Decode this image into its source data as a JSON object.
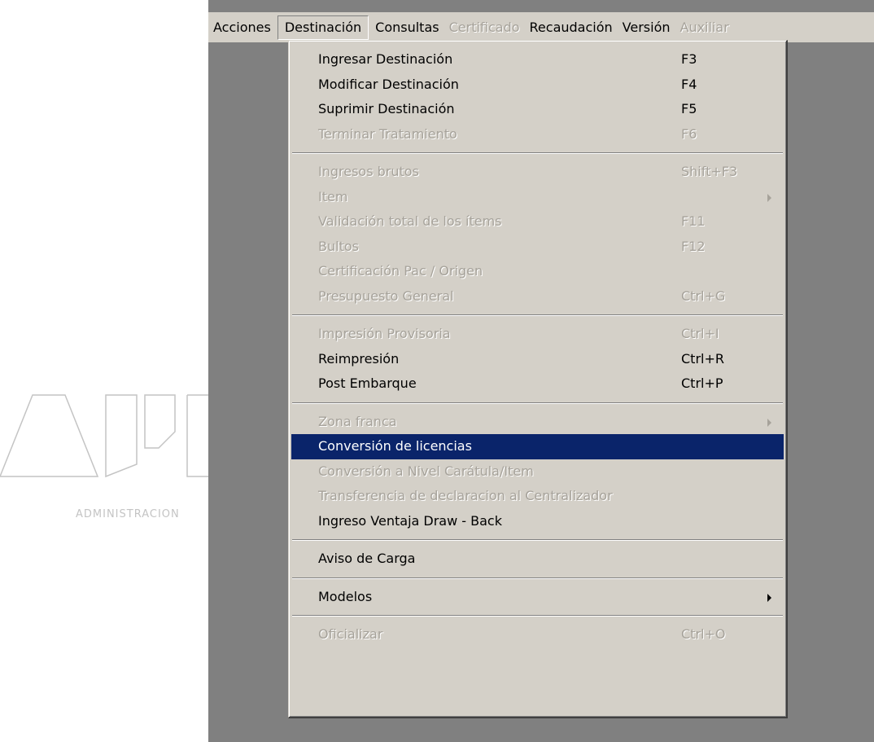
{
  "logo": {
    "caption": "ADMINISTRACION"
  },
  "menubar": {
    "items": [
      {
        "label": "Acciones",
        "disabled": false
      },
      {
        "label": "Destinación",
        "disabled": false,
        "open": true
      },
      {
        "label": "Consultas",
        "disabled": false
      },
      {
        "label": "Certificado",
        "disabled": true
      },
      {
        "label": "Recaudación",
        "disabled": false
      },
      {
        "label": "Versión",
        "disabled": false
      },
      {
        "label": "Auxiliar",
        "disabled": true
      }
    ]
  },
  "dropdown": {
    "groups": [
      [
        {
          "label": "Ingresar Destinación",
          "shortcut": "F3",
          "disabled": false
        },
        {
          "label": "Modificar Destinación",
          "shortcut": "F4",
          "disabled": false
        },
        {
          "label": "Suprimir Destinación",
          "shortcut": "F5",
          "disabled": false
        },
        {
          "label": "Terminar Tratamiento",
          "shortcut": "F6",
          "disabled": true
        }
      ],
      [
        {
          "label": "Ingresos brutos",
          "shortcut": "Shift+F3",
          "disabled": true
        },
        {
          "label": "Item",
          "shortcut": "",
          "disabled": true,
          "submenu": true
        },
        {
          "label": "Validación total de los ítems",
          "shortcut": "F11",
          "disabled": true
        },
        {
          "label": "Bultos",
          "shortcut": "F12",
          "disabled": true
        },
        {
          "label": "Certificación Pac / Origen",
          "shortcut": "",
          "disabled": true
        },
        {
          "label": "Presupuesto General",
          "shortcut": "Ctrl+G",
          "disabled": true
        }
      ],
      [
        {
          "label": "Impresión Provisoria",
          "shortcut": "Ctrl+I",
          "disabled": true
        },
        {
          "label": "Reimpresión",
          "shortcut": "Ctrl+R",
          "disabled": false
        },
        {
          "label": "Post Embarque",
          "shortcut": "Ctrl+P",
          "disabled": false
        }
      ],
      [
        {
          "label": "Zona franca",
          "shortcut": "",
          "disabled": true,
          "submenu": true
        },
        {
          "label": "Conversión de licencias",
          "shortcut": "",
          "disabled": false,
          "selected": true
        },
        {
          "label": "Conversión a Nivel Carátula/Item",
          "shortcut": "",
          "disabled": true
        },
        {
          "label": "Transferencia de declaracion al Centralizador",
          "shortcut": "",
          "disabled": true
        },
        {
          "label": "Ingreso Ventaja Draw - Back",
          "shortcut": "",
          "disabled": false
        }
      ],
      [
        {
          "label": "Aviso de Carga",
          "shortcut": "",
          "disabled": false
        }
      ],
      [
        {
          "label": "Modelos",
          "shortcut": "",
          "disabled": false,
          "submenu": true
        }
      ],
      [
        {
          "label": "Oficializar",
          "shortcut": "Ctrl+O",
          "disabled": true
        }
      ]
    ]
  },
  "colors": {
    "menu_bg": "#d4d0c8",
    "app_bg": "#808080",
    "highlight_bg": "#0a246a",
    "disabled_text": "#a6a29a"
  }
}
